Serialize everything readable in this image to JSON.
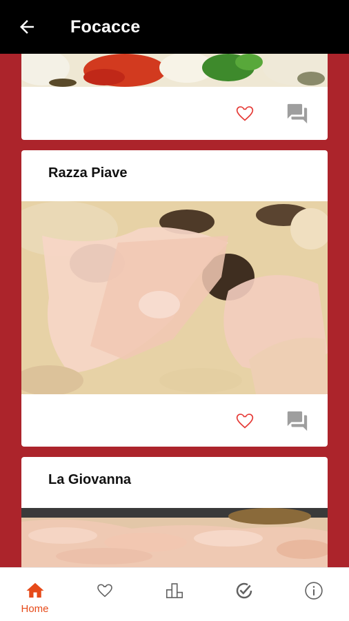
{
  "appbar": {
    "title": "Focacce",
    "back_icon": "arrow-back-icon"
  },
  "cards": [
    {
      "title": "",
      "icons": [
        "heart-outline-icon",
        "comment-icon"
      ]
    },
    {
      "title": "Razza Piave",
      "icons": [
        "heart-outline-icon",
        "comment-icon"
      ]
    },
    {
      "title": "La Giovanna",
      "icons": []
    }
  ],
  "bottom_nav": {
    "items": [
      {
        "label": "Home",
        "icon": "home-icon",
        "active": true
      },
      {
        "label": "",
        "icon": "heart-outline-icon",
        "active": false
      },
      {
        "label": "",
        "icon": "leaderboard-icon",
        "active": false
      },
      {
        "label": "",
        "icon": "check-circle-icon",
        "active": false
      },
      {
        "label": "",
        "icon": "info-icon",
        "active": false
      }
    ]
  },
  "colors": {
    "background": "#ac242b",
    "appbar": "#000000",
    "accent": "#e64a19",
    "heart": "#e53935",
    "comment": "#9e9e9e"
  }
}
